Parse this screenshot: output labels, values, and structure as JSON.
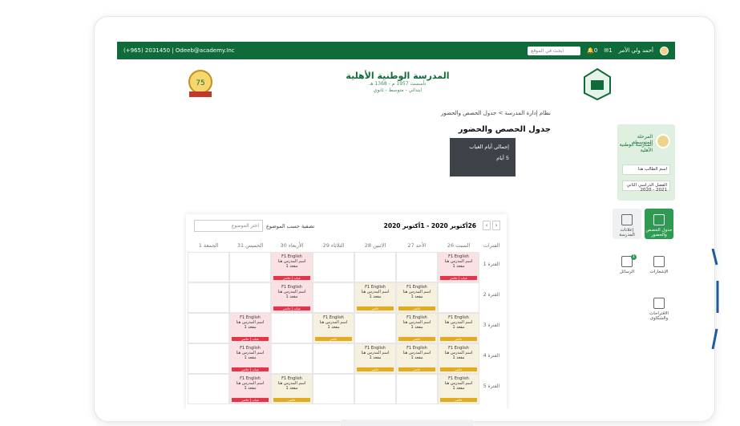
{
  "topbar": {
    "phone": "(+965) 2031450  |  Odeeb@academy.Inc",
    "search_placeholder": "ابحث في الموقع",
    "notif_count": "0",
    "msg_count": "1",
    "user": "أحمد ولي الأمر"
  },
  "school": {
    "name": "المدرسة الوطنية الأهلية",
    "founded": "تأسست 1957 م - 1368 هـ",
    "levels": "ابتدائي - متوسط - ثانوي"
  },
  "breadcrumb": "نظام إدارة المدرسة  >  جدول الحصص والحضور",
  "page_title": "جدول الحصص والحضور",
  "absence": {
    "label": "إجمالي أيام الغياب",
    "value": "5 أيام"
  },
  "profile": {
    "stage": "المرحلة المتوسطة",
    "school": "المدرسة الوطنية الأهلية",
    "student": "اسم الطالب هنا",
    "term": "الفصل الدراسي الثاني 2021 - 2020"
  },
  "tiles": [
    {
      "label": "جدول الحصص والحضور",
      "icon": "calendar-icon"
    },
    {
      "label": "إعلانات المدرسة",
      "icon": "megaphone-icon"
    },
    {
      "label": "الإشعارات",
      "icon": "bell-icon"
    },
    {
      "label": "الرسائل",
      "icon": "mail-icon",
      "badge": "1"
    },
    {
      "label": "الاقتراحات والشكاوى",
      "icon": "lightbulb-icon"
    }
  ],
  "schedule": {
    "range": "26أكتوبر 2020 - 1أكتوبر 2020",
    "filter_label": "تصفية حسب الموضوع",
    "select_placeholder": "اختر الموضوع",
    "days": [
      "الفترات",
      "السبت 26",
      "الأحد 27",
      "الاثنين 28",
      "الثلاثاء 29",
      "الأربعاء 30",
      "الخميس 31",
      "الجمعة 1"
    ],
    "periods": [
      "الفترة 1",
      "الفترة 2",
      "الفترة 3",
      "الفترة 4",
      "الفترة 5"
    ],
    "class_title": "F1 English",
    "teacher": "اسم المدرس هنا",
    "seat": "مقعد 1",
    "absent_tag": "غياب | حاضر",
    "present_tag": "حاضر"
  },
  "colors": {
    "brand": "#0f6b3a",
    "red": "#e5354a",
    "yellow": "#e3ac1e"
  }
}
